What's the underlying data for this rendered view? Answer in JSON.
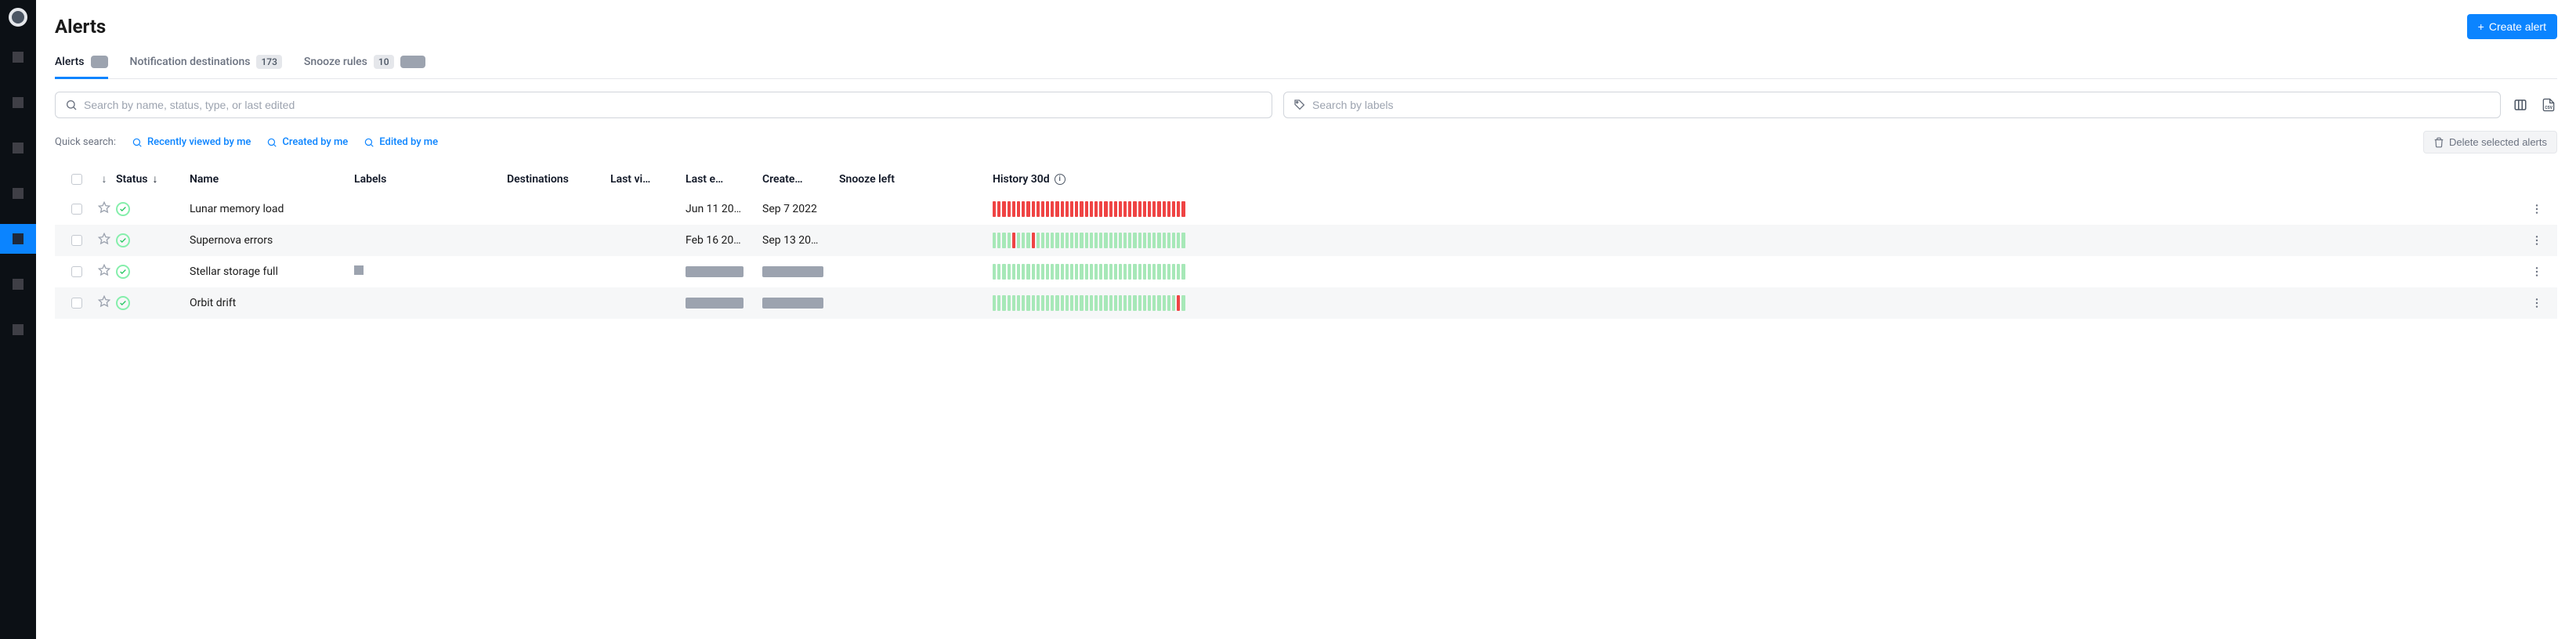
{
  "page_title": "Alerts",
  "create_button": "Create alert",
  "tabs": [
    {
      "label": "Alerts",
      "badge": ""
    },
    {
      "label": "Notification destinations",
      "badge": "173"
    },
    {
      "label": "Snooze rules",
      "badge": "10"
    }
  ],
  "search_placeholder": "Search by name, status, type, or last edited",
  "label_search_placeholder": "Search by labels",
  "quick_search_label": "Quick search:",
  "quick_links": [
    "Recently viewed by me",
    "Created by me",
    "Edited by me"
  ],
  "delete_button": "Delete selected alerts",
  "columns": {
    "status": "Status",
    "name": "Name",
    "labels": "Labels",
    "destinations": "Destinations",
    "last_vi": "Last vi…",
    "last_edit": "Last e…",
    "created": "Create…",
    "snooze": "Snooze left",
    "history": "History 30d"
  },
  "rows": [
    {
      "name": "Lunar memory load",
      "last_edit": "Jun 11 20…",
      "created": "Sep 7 2022",
      "history": "rrrrrrrrrrrrrrrrrrrrrrrrrrrrrrrrrrrrrrrr",
      "has_label": false,
      "blank_dates": false
    },
    {
      "name": "Supernova errors",
      "last_edit": "Feb 16 20…",
      "created": "Sep 13 20…",
      "history": "ggggrgggrggggggggggggggggggggggggggggggg",
      "has_label": false,
      "blank_dates": false
    },
    {
      "name": "Stellar storage full",
      "last_edit": "",
      "created": "",
      "history": "gggggggggggggggggggggggggggggggggggggggg",
      "has_label": true,
      "blank_dates": true
    },
    {
      "name": "Orbit drift",
      "last_edit": "",
      "created": "",
      "history": "ggggggggggggggggggggggggggggggggggggggrg",
      "has_label": false,
      "blank_dates": true
    }
  ]
}
